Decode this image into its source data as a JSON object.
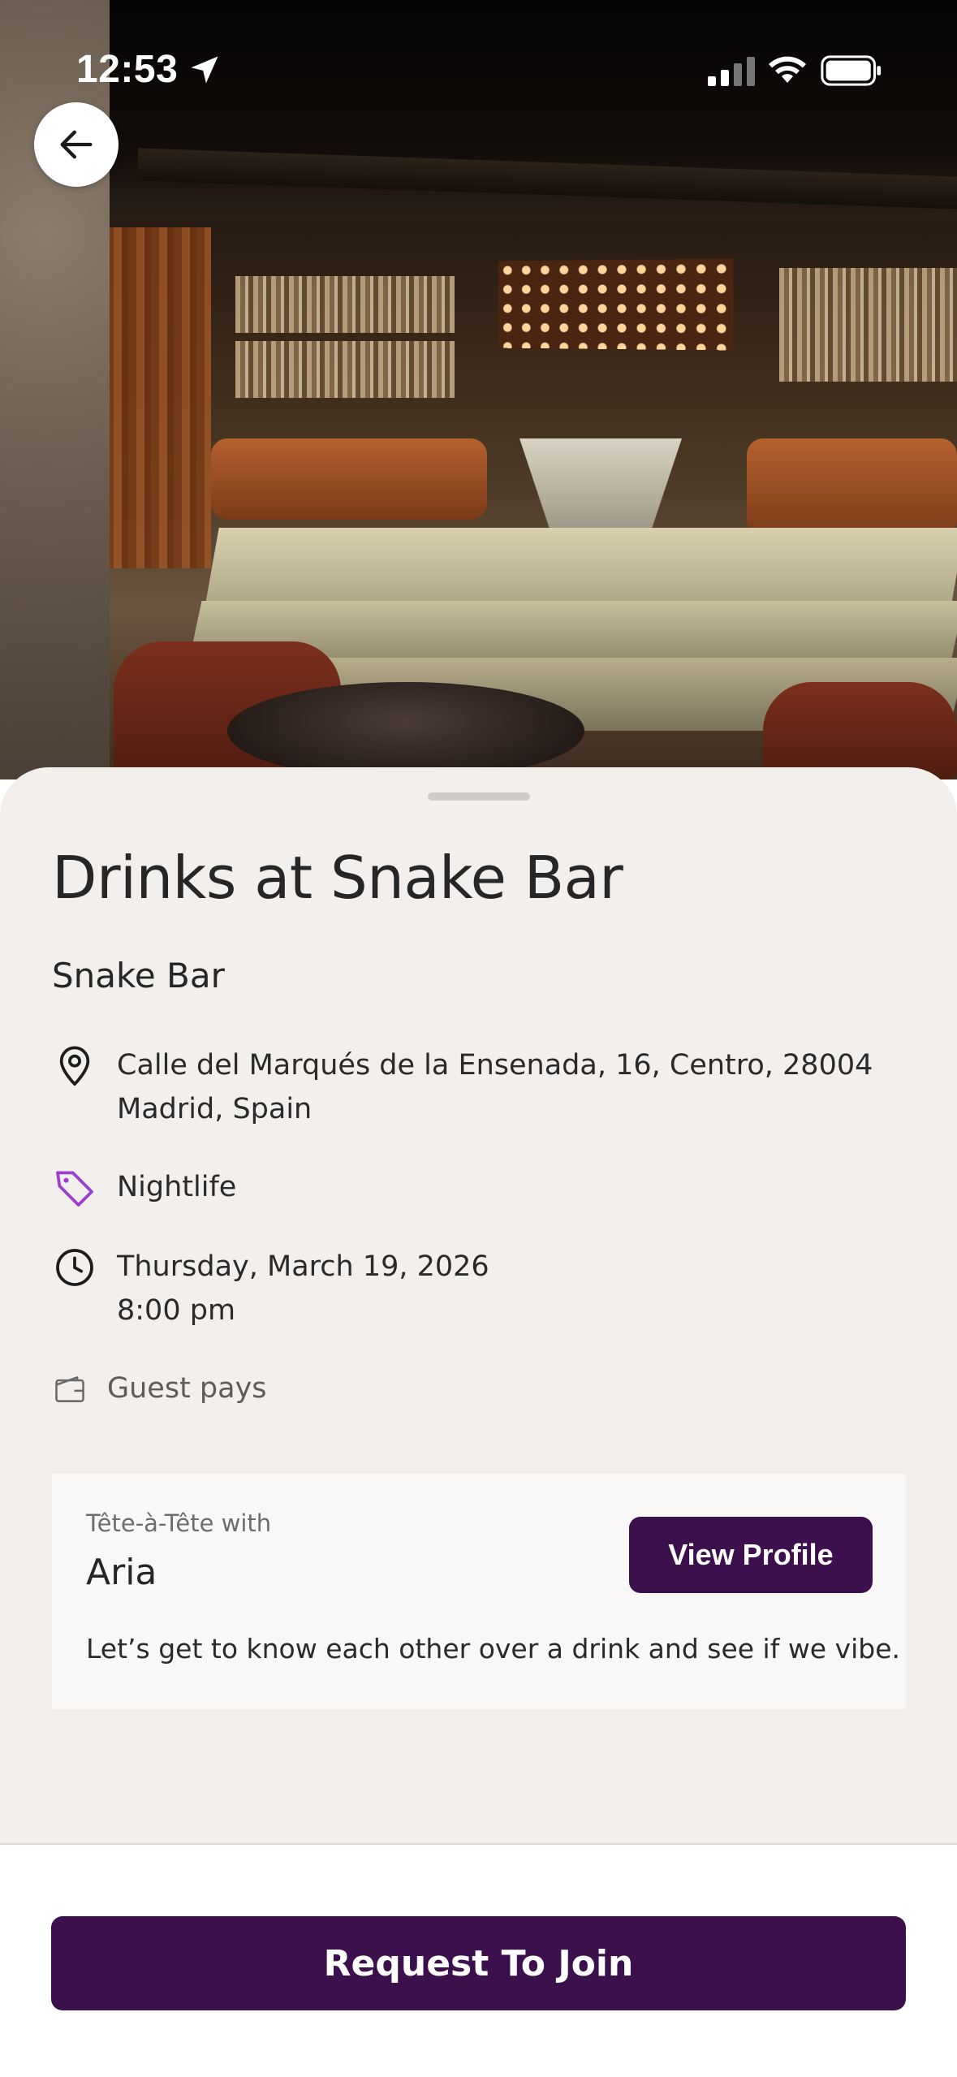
{
  "status_bar": {
    "time": "12:53",
    "location_icon": "location-arrow-icon",
    "signal_icon": "cellular-signal-icon",
    "wifi_icon": "wifi-icon",
    "battery_icon": "battery-icon"
  },
  "header": {
    "back_icon": "arrow-left-icon"
  },
  "event": {
    "title": "Drinks at Snake Bar",
    "venue": "Snake Bar",
    "address_line1": "Calle del Marqués de la Ensenada, 16, Centro, 28004",
    "address_line2": "Madrid, Spain",
    "category": "Nightlife",
    "date": "Thursday, March 19, 2026",
    "time": "8:00 pm",
    "payment": "Guest pays"
  },
  "host_card": {
    "label": "Tête-à-Tête with",
    "name": "Aria",
    "view_profile_label": "View Profile",
    "message": "Let’s get to know each other over a drink and see if we vibe."
  },
  "footer": {
    "cta_label": "Request To Join"
  },
  "colors": {
    "primary": "#3c0f4d",
    "tag_accent": "#9b3fd1",
    "sheet_background": "#f2efec"
  }
}
